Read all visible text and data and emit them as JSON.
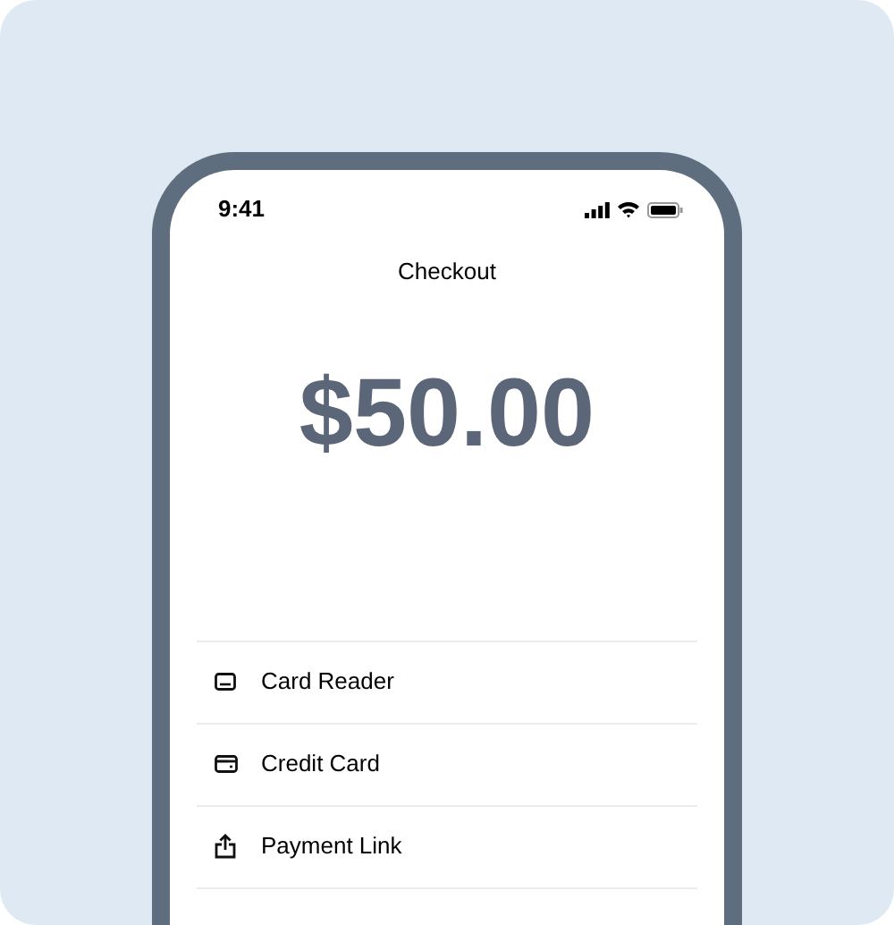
{
  "status_bar": {
    "time": "9:41"
  },
  "title": "Checkout",
  "amount": "$50.00",
  "payment_methods": [
    {
      "label": "Card Reader",
      "kind": "reader"
    },
    {
      "label": "Credit Card",
      "kind": "card"
    },
    {
      "label": "Payment Link",
      "kind": "share"
    }
  ]
}
